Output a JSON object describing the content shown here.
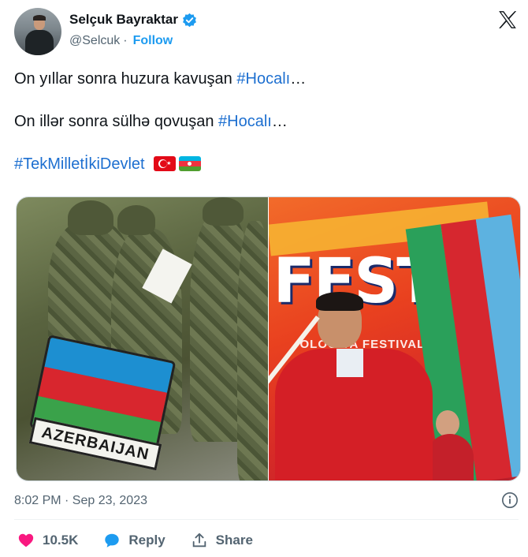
{
  "author": {
    "name": "Selçuk Bayraktar",
    "handle": "@Selcuk",
    "separator": "·",
    "follow_label": "Follow"
  },
  "tweet": {
    "line1_text": "On yıllar sonra huzura kavuşan ",
    "line1_hashtag": "#Hocalı",
    "line1_suffix": "…",
    "line2_text": "On illər sonra sülhə qovuşan ",
    "line2_hashtag": "#Hocalı",
    "line2_suffix": "…",
    "line3_hashtag": "#TekMilletİkiDevlet",
    "emoji_flags": [
      "flag-turkey",
      "flag-azerbaijan"
    ]
  },
  "media": {
    "left_patch_text": "AZERBAIJAN",
    "right_banner_text": "FEST",
    "right_banner_subtext": "OLOGIYA FESTIVALI"
  },
  "timestamp": "8:02 PM · Sep 23, 2023",
  "actions": {
    "like_count": "10.5K",
    "reply_label": "Reply",
    "share_label": "Share"
  },
  "colors": {
    "accent": "#1d9bf0",
    "hashtag": "#1d6fd0",
    "like": "#f91880",
    "muted": "#536471"
  },
  "icons": [
    "verified-badge-icon",
    "x-logo-icon",
    "info-icon",
    "heart-icon",
    "reply-icon",
    "share-icon"
  ]
}
